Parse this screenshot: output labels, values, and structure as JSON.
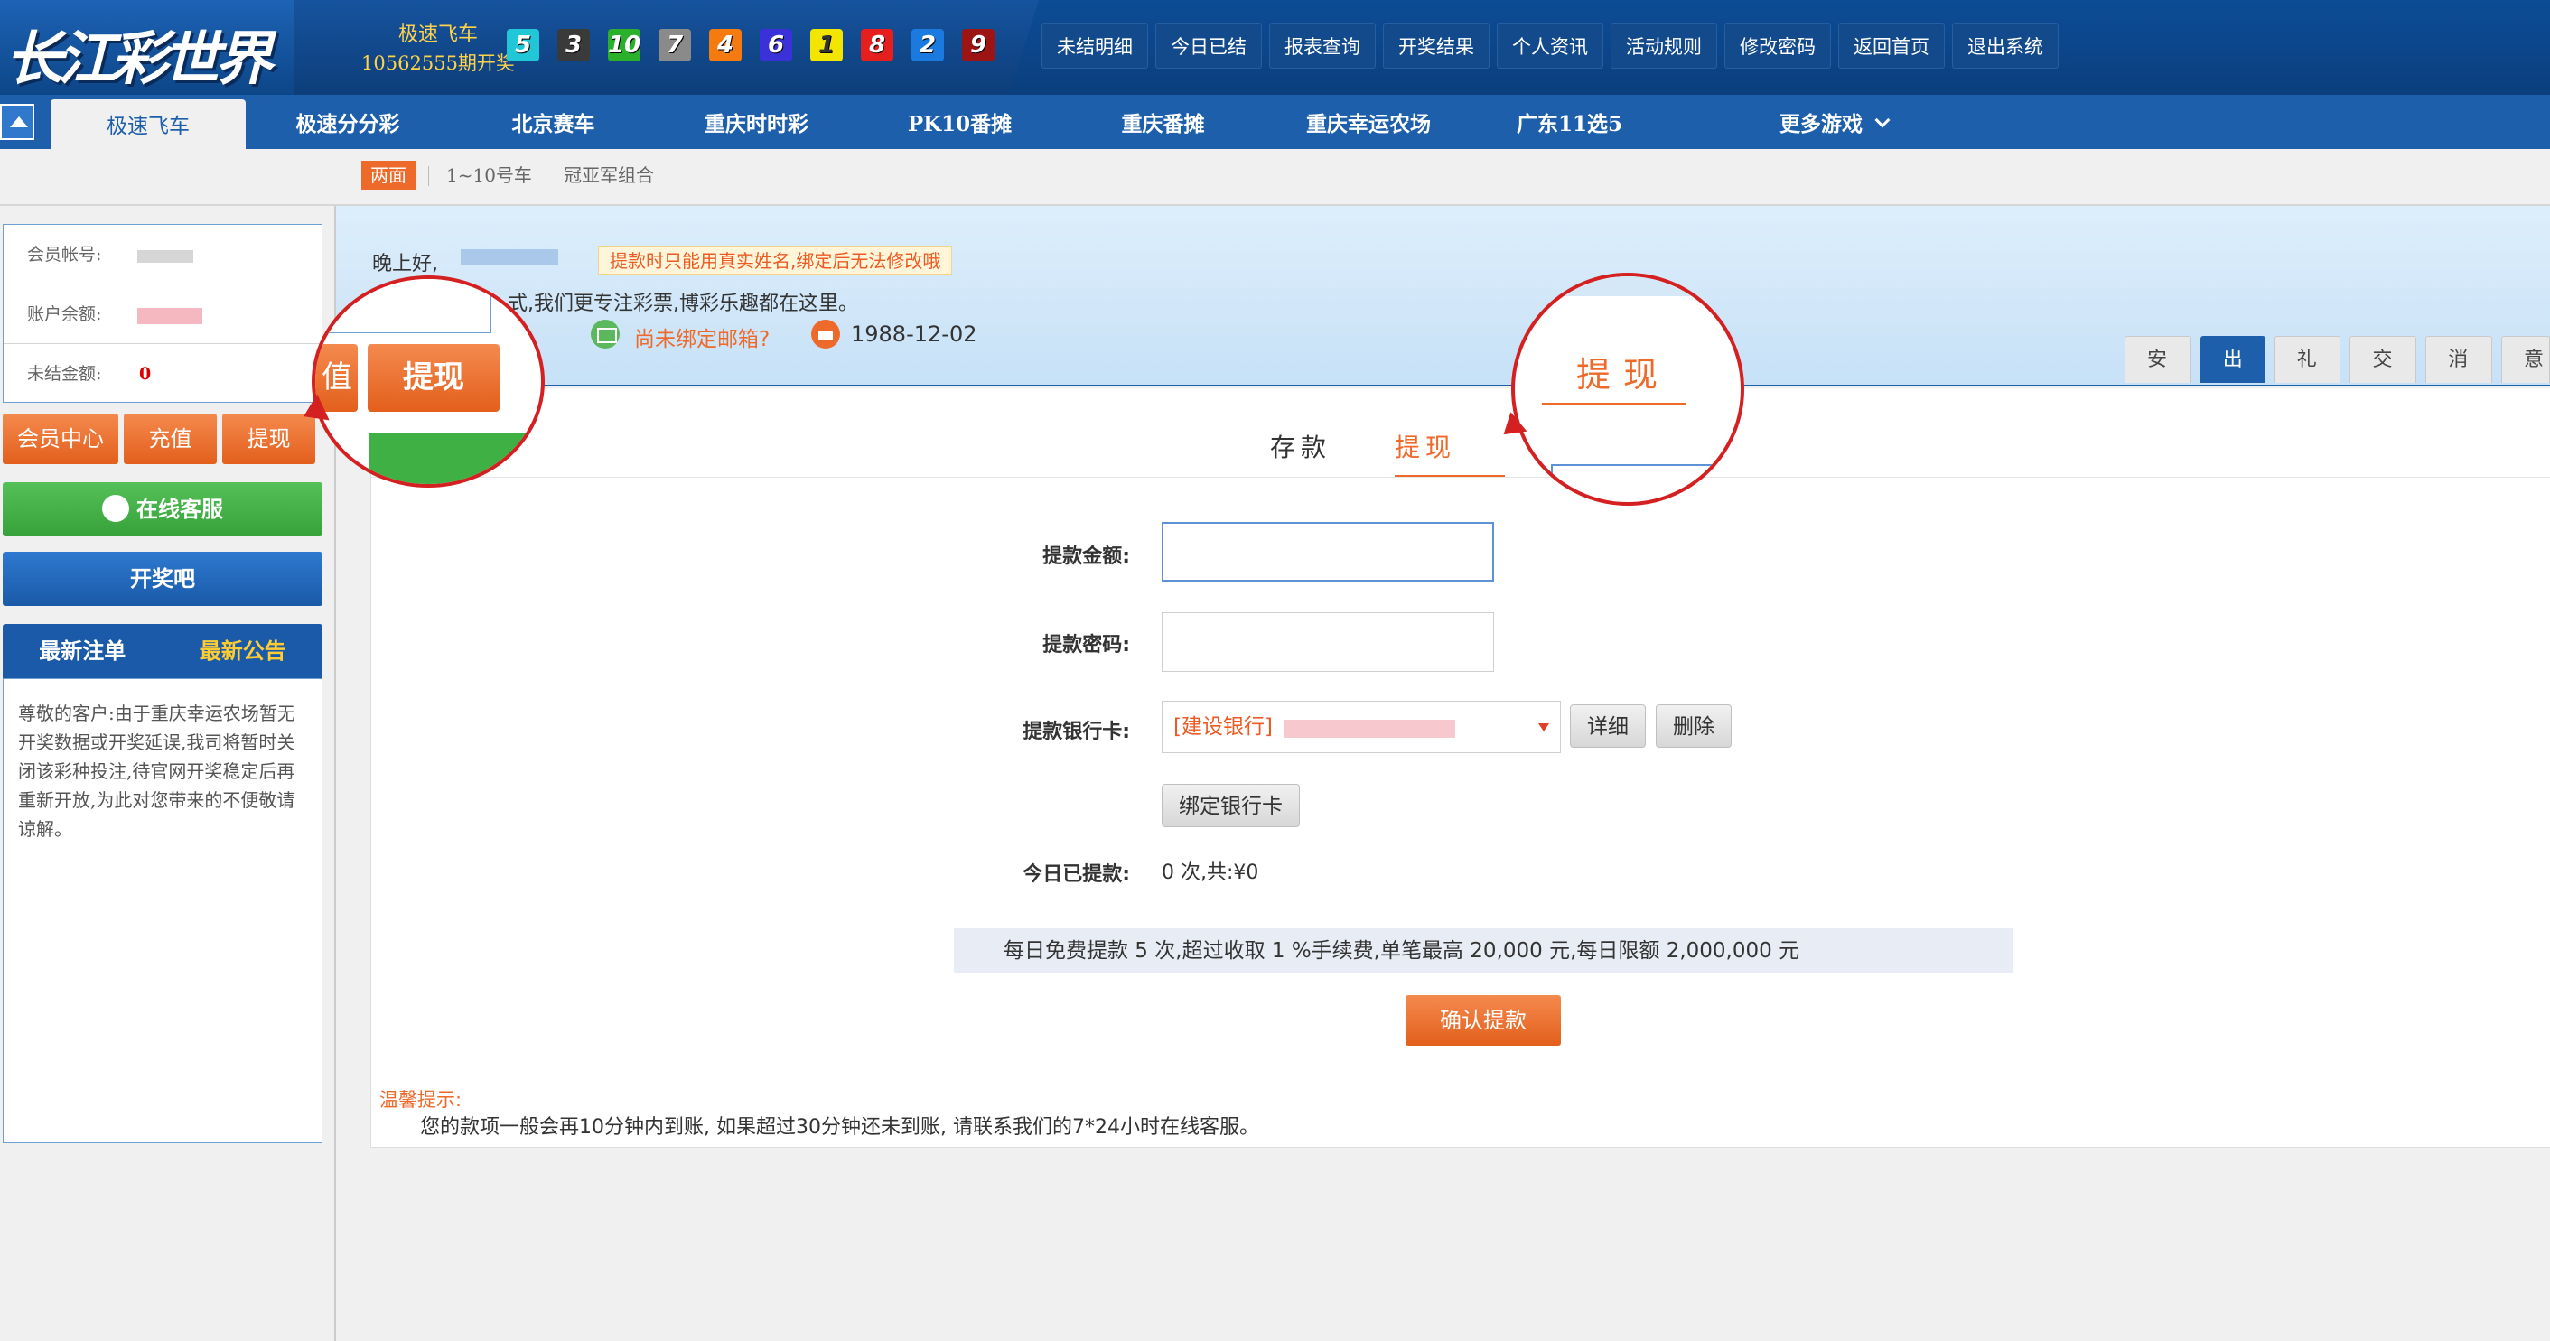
{
  "header": {
    "logo_text": "长江彩世界",
    "lottery_name": "极速飞车",
    "period": "10562555期开奖",
    "balls": [
      {
        "n": "5",
        "color": "#21c7d6"
      },
      {
        "n": "3",
        "color": "#3a3a3a"
      },
      {
        "n": "10",
        "color": "#2bb02b"
      },
      {
        "n": "7",
        "color": "#8a8a8a"
      },
      {
        "n": "4",
        "color": "#f57a10"
      },
      {
        "n": "6",
        "color": "#3a31d8"
      },
      {
        "n": "1",
        "color": "#f2e600"
      },
      {
        "n": "8",
        "color": "#e51e1e"
      },
      {
        "n": "2",
        "color": "#1a7ae0"
      },
      {
        "n": "9",
        "color": "#9c1414"
      }
    ],
    "nav": [
      "未结明细",
      "今日已结",
      "报表查询",
      "开奖结果",
      "个人资讯",
      "活动规则",
      "修改密码",
      "返回首页",
      "退出系统"
    ]
  },
  "games": {
    "tabs": [
      "极速飞车",
      "极速分分彩",
      "北京赛车",
      "重庆时时彩",
      "PK10番摊",
      "重庆番摊",
      "重庆幸运农场",
      "广东11选5"
    ],
    "more": "更多游戏"
  },
  "subnav": {
    "active": "两面",
    "items": [
      "1~10号车",
      "冠亚军组合"
    ]
  },
  "sidebar": {
    "account_label": "会员帐号:",
    "balance_label": "账户余额:",
    "unsettled_label": "未结金额:",
    "unsettled_value": "0",
    "buttons": [
      "会员中心",
      "充值",
      "提现"
    ],
    "service": "在线客服",
    "kaijiang": "开奖吧",
    "notice_tabs": [
      "最新注单",
      "最新公告"
    ],
    "notice": "尊敬的客户:由于重庆幸运农场暂无开奖数据或开奖延误,我司将暂时关闭该彩种投注,待官网开奖稳定后再重新开放,为此对您带来的不便敬请谅解。"
  },
  "greeting": {
    "line1_prefix": "晚上好,",
    "tip": "提款时只能用真实姓名,绑定后无法修改哦",
    "line2": "式,我们更专注彩票,博彩乐趣都在这里。",
    "email": "尚未绑定邮箱?",
    "birthday": "1988-12-02"
  },
  "user_tabs": [
    "安全设置",
    "出纳台",
    "礼品地址",
    "交易记录",
    "消息中心",
    "意见"
  ],
  "cashier": {
    "tabs": [
      "存款",
      "提现"
    ],
    "amount_label": "提款金额:",
    "password_label": "提款密码:",
    "card_label": "提款银行卡:",
    "card_value": "[建设银行]",
    "detail_btn": "详细",
    "delete_btn": "删除",
    "bind_btn": "绑定银行卡",
    "today_label": "今日已提款:",
    "today_value": "0 次,共:¥0",
    "free_note": "每日免费提款 5 次,超过收取 1 %手续费,单笔最高 20,000 元,每日限额 2,000,000 元",
    "confirm": "确认提款",
    "warm_title": "温馨提示:",
    "warm_text": "您的款项一般会再10分钟内到账, 如果超过30分钟还未到账, 请联系我们的7*24小时在线客服。"
  },
  "callouts": {
    "left_partial": "值",
    "left_btn": "提现",
    "right_tab": "提现"
  }
}
